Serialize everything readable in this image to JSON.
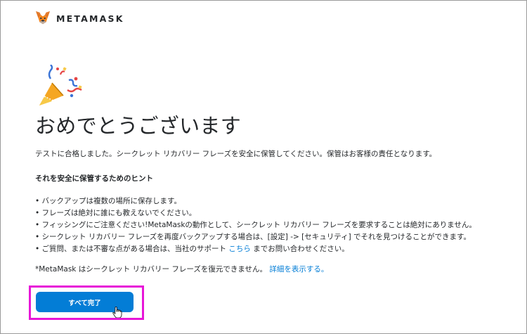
{
  "header": {
    "brand": "METAMASK",
    "logo_icon": "fox-icon"
  },
  "hero": {
    "icon": "party-popper-icon"
  },
  "main": {
    "title": "おめでとうございます",
    "intro": "テストに合格しました。シークレット リカバリー フレーズを安全に保管してください。保管はお客様の責任となります。",
    "hint_title": "それを安全に保管するためのヒント",
    "bullets": [
      "バックアップは複数の場所に保存します。",
      "フレーズは絶対に誰にも教えないでください。",
      "フィッシングにご注意ください!MetaMaskの動作として、シークレット リカバリー フレーズを要求することは絶対にありません。",
      "シークレット リカバリー フレーズを再度バックアップする場合は、[設定] -> [セキュリティ] でそれを見つけることができます。"
    ],
    "support_prefix": "ご質問、または不審な点がある場合は、当社のサポート ",
    "support_link": "こちら",
    "support_suffix": " までお問い合わせください。",
    "note_prefix": "*MetaMask はシークレット リカバリー フレーズを復元できません。",
    "note_link": "詳細を表示する。"
  },
  "actions": {
    "done_label": "すべて完了"
  },
  "colors": {
    "accent": "#037dd6",
    "highlight": "#e716d8",
    "text": "#24272a"
  }
}
